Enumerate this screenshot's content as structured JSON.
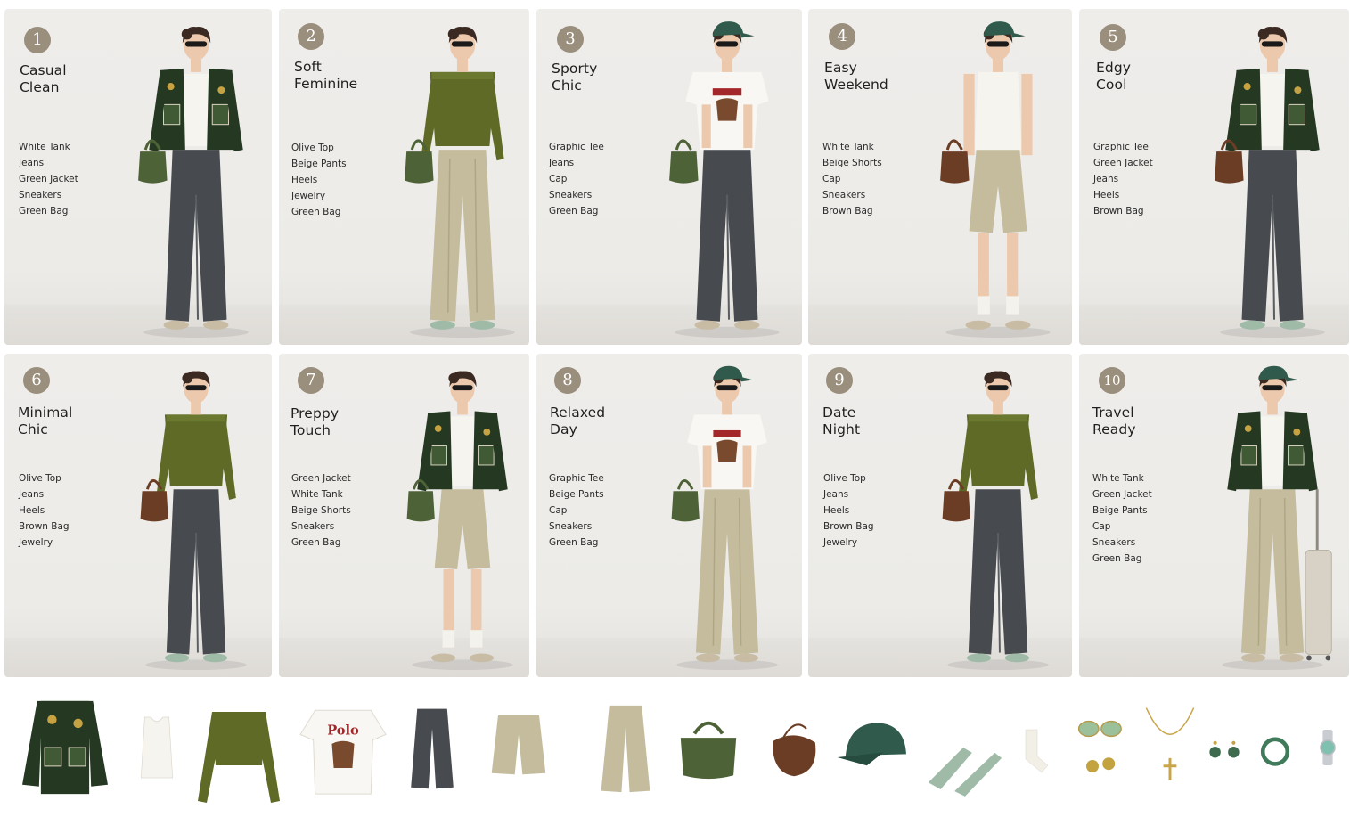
{
  "outfits": [
    {
      "number": "1",
      "title": [
        "Casual",
        "Clean"
      ],
      "items": [
        "White Tank",
        "Jeans",
        "Green Jacket",
        "Sneakers",
        "Green Bag"
      ],
      "top": "jacket",
      "bottom": "jeans",
      "bag": "green",
      "shoes": "sneakers",
      "hat": false
    },
    {
      "number": "2",
      "title": [
        "Soft",
        "Feminine"
      ],
      "items": [
        "Olive Top",
        "Beige Pants",
        "Heels",
        "Jewelry",
        "Green Bag"
      ],
      "top": "olive",
      "bottom": "beige-pants",
      "bag": "green",
      "shoes": "heels",
      "hat": false
    },
    {
      "number": "3",
      "title": [
        "Sporty",
        "Chic"
      ],
      "items": [
        "Graphic Tee",
        "Jeans",
        "Cap",
        "Sneakers",
        "Green Bag"
      ],
      "top": "tee",
      "bottom": "jeans",
      "bag": "green",
      "shoes": "sneakers",
      "hat": true
    },
    {
      "number": "4",
      "title": [
        "Easy",
        "Weekend"
      ],
      "items": [
        "White Tank",
        "Beige Shorts",
        "Cap",
        "Sneakers",
        "Brown Bag"
      ],
      "top": "tank",
      "bottom": "shorts",
      "bag": "brown",
      "shoes": "sneakers",
      "hat": true
    },
    {
      "number": "5",
      "title": [
        "Edgy",
        "Cool"
      ],
      "items": [
        "Graphic Tee",
        "Green Jacket",
        "Jeans",
        "Heels",
        "Brown Bag"
      ],
      "top": "jacket",
      "bottom": "jeans",
      "bag": "brown",
      "shoes": "heels",
      "hat": false
    },
    {
      "number": "6",
      "title": [
        "Minimal",
        "Chic"
      ],
      "items": [
        "Olive Top",
        "Jeans",
        "Heels",
        "Brown Bag",
        "Jewelry"
      ],
      "top": "olive",
      "bottom": "jeans",
      "bag": "brown",
      "shoes": "heels",
      "hat": false
    },
    {
      "number": "7",
      "title": [
        "Preppy",
        "Touch"
      ],
      "items": [
        "Green Jacket",
        "White Tank",
        "Beige Shorts",
        "Sneakers",
        "Green Bag"
      ],
      "top": "jacket",
      "bottom": "shorts",
      "bag": "green",
      "shoes": "sneakers",
      "hat": false
    },
    {
      "number": "8",
      "title": [
        "Relaxed",
        "Day"
      ],
      "items": [
        "Graphic Tee",
        "Beige Pants",
        "Cap",
        "Sneakers",
        "Green Bag"
      ],
      "top": "tee",
      "bottom": "beige-pants",
      "bag": "green",
      "shoes": "sneakers",
      "hat": true
    },
    {
      "number": "9",
      "title": [
        "Date",
        "Night"
      ],
      "items": [
        "Olive Top",
        "Jeans",
        "Heels",
        "Brown Bag",
        "Jewelry"
      ],
      "top": "olive",
      "bottom": "jeans",
      "bag": "brown",
      "shoes": "heels",
      "hat": false
    },
    {
      "number": "10",
      "title": [
        "Travel",
        "Ready"
      ],
      "items": [
        "White Tank",
        "Green Jacket",
        "Beige Pants",
        "Cap",
        "Sneakers",
        "Green Bag"
      ],
      "top": "jacket",
      "bottom": "beige-pants",
      "bag": "none",
      "shoes": "sneakers",
      "hat": true,
      "suitcase": true
    }
  ],
  "products": [
    {
      "name": "green-jacket"
    },
    {
      "name": "white-tank"
    },
    {
      "name": "olive-top"
    },
    {
      "name": "graphic-tee",
      "label": "Polo"
    },
    {
      "name": "jeans"
    },
    {
      "name": "beige-shorts"
    },
    {
      "name": "beige-pants"
    },
    {
      "name": "green-bag"
    },
    {
      "name": "brown-bag"
    },
    {
      "name": "cap"
    },
    {
      "name": "heels"
    },
    {
      "name": "socks"
    },
    {
      "name": "sunglasses-earrings"
    },
    {
      "name": "necklace"
    },
    {
      "name": "earrings"
    },
    {
      "name": "bracelet"
    },
    {
      "name": "watch"
    }
  ],
  "colors": {
    "jacket": "#243822",
    "jacketPatch": "#3f5a34",
    "jacketTrim": "#d8d2bd",
    "olive": "#5e6a26",
    "tank": "#f6f4ef",
    "tee": "#f8f7f3",
    "teeRed": "#a3262a",
    "jeans": "#474a4f",
    "jeansLight": "#5a5d62",
    "beige": "#c4bc9c",
    "beigeDark": "#aea685",
    "greenBag": "#4d6236",
    "brownBag": "#6b3d24",
    "cap": "#2f5a4c",
    "skin": "#ecc8ac",
    "hair": "#3a2a22",
    "heels": "#9fbba8",
    "sneaker": "#c8bca4",
    "badge": "#9a8e7c"
  }
}
